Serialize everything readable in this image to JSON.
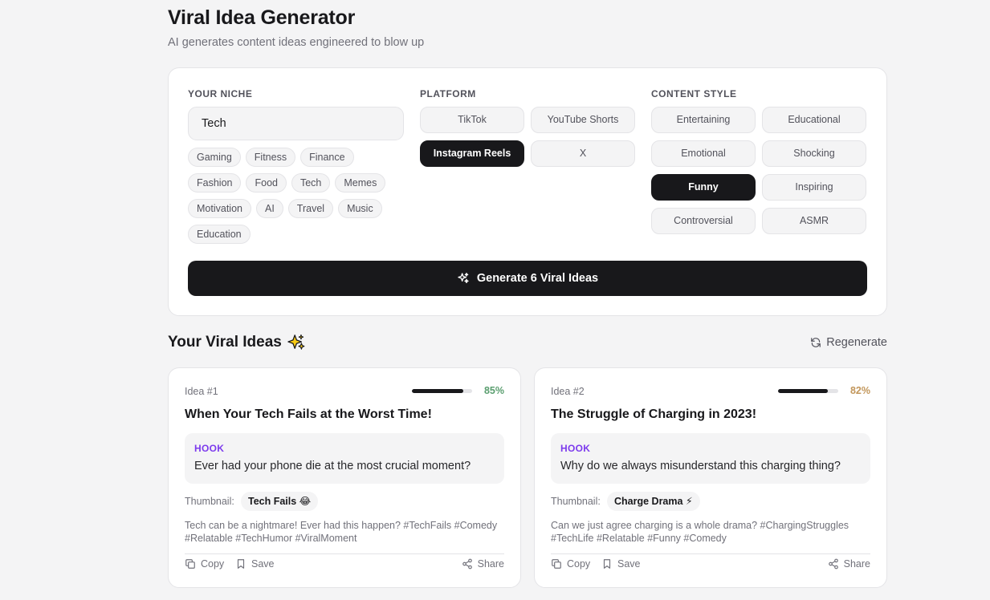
{
  "header": {
    "title": "Viral Idea Generator",
    "subtitle": "AI generates content ideas engineered to blow up"
  },
  "form": {
    "niche_label": "YOUR NICHE",
    "niche_value": "Tech",
    "niche_chips": [
      "Gaming",
      "Fitness",
      "Finance",
      "Fashion",
      "Food",
      "Tech",
      "Memes",
      "Motivation",
      "AI",
      "Travel",
      "Music",
      "Education"
    ],
    "platform_label": "PLATFORM",
    "platforms": [
      "TikTok",
      "YouTube Shorts",
      "Instagram Reels",
      "X"
    ],
    "platform_selected": "Instagram Reels",
    "style_label": "CONTENT STYLE",
    "styles": [
      "Entertaining",
      "Educational",
      "Emotional",
      "Shocking",
      "Funny",
      "Inspiring",
      "Controversial",
      "ASMR"
    ],
    "style_selected": "Funny",
    "generate_label": "Generate 6 Viral Ideas"
  },
  "results": {
    "title": "Your Viral Ideas",
    "regenerate_label": "Regenerate",
    "ideas": [
      {
        "number": "Idea #1",
        "score": 85,
        "score_label": "85%",
        "score_color": "#5a9e6f",
        "title": "When Your Tech Fails at the Worst Time!",
        "hook_label": "HOOK",
        "hook": "Ever had your phone die at the most crucial moment?",
        "thumbnail_label": "Thumbnail:",
        "thumbnail": "Tech Fails 😂",
        "caption": "Tech can be a nightmare! Ever had this happen? #TechFails #Comedy #Relatable #TechHumor #ViralMoment",
        "copy_label": "Copy",
        "save_label": "Save",
        "share_label": "Share"
      },
      {
        "number": "Idea #2",
        "score": 82,
        "score_label": "82%",
        "score_color": "#c2965a",
        "title": "The Struggle of Charging in 2023!",
        "hook_label": "HOOK",
        "hook": "Why do we always misunderstand this charging thing?",
        "thumbnail_label": "Thumbnail:",
        "thumbnail": "Charge Drama ⚡",
        "caption": "Can we just agree charging is a whole drama? #ChargingStruggles #TechLife #Relatable #Funny #Comedy",
        "copy_label": "Copy",
        "save_label": "Save",
        "share_label": "Share"
      }
    ]
  },
  "icons": {
    "generate": "sparkles-icon",
    "results_title": "sparkles-icon",
    "regenerate": "refresh-icon",
    "copy": "copy-icon",
    "save": "bookmark-icon",
    "share": "share-icon"
  },
  "colors": {
    "accent_dark": "#18181b",
    "hook_purple": "#7c3aed",
    "background": "#f4f4f5"
  }
}
